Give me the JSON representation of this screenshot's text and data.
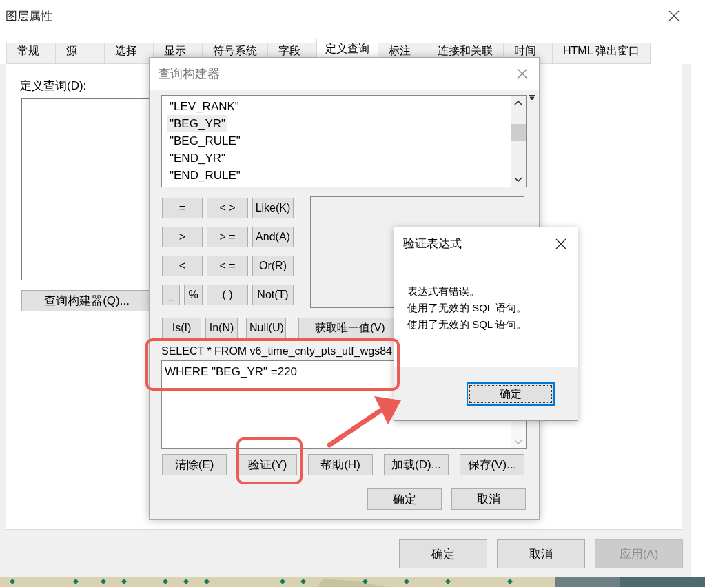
{
  "window": {
    "title": "图层属性"
  },
  "tabs": [
    {
      "label": "常规",
      "selected": false
    },
    {
      "label": "源",
      "selected": false
    },
    {
      "label": "选择",
      "selected": false
    },
    {
      "label": "显示",
      "selected": false
    },
    {
      "label": "符号系统",
      "selected": false
    },
    {
      "label": "字段",
      "selected": false
    },
    {
      "label": "定义查询",
      "selected": true
    },
    {
      "label": "标注",
      "selected": false
    },
    {
      "label": "连接和关联",
      "selected": false
    },
    {
      "label": "时间",
      "selected": false
    },
    {
      "label": "HTML 弹出窗口",
      "selected": false
    }
  ],
  "definition_query": {
    "label": "定义查询(D):",
    "builder_button": "查询构建器(Q)..."
  },
  "buttons": [
    {
      "label": "确定",
      "disabled": false
    },
    {
      "label": "取消",
      "disabled": false
    },
    {
      "label": "应用(A)",
      "disabled": true
    }
  ],
  "query_builder": {
    "title": "查询构建器",
    "fields": [
      {
        "label": "\"LEV_RANK\"",
        "selected": false
      },
      {
        "label": "\"BEG_YR\"",
        "selected": true
      },
      {
        "label": "\"BEG_RULE\"",
        "selected": false
      },
      {
        "label": "\"END_YR\"",
        "selected": false
      },
      {
        "label": "\"END_RULE\"",
        "selected": false
      }
    ],
    "operators": [
      {
        "label": "=",
        "kind": "wide"
      },
      {
        "label": "< >",
        "kind": "wide"
      },
      {
        "label": "Like(K)",
        "kind": "wide"
      },
      {
        "label": ">",
        "kind": "wide"
      },
      {
        "label": "> =",
        "kind": "wide"
      },
      {
        "label": "And(A)",
        "kind": "wide"
      },
      {
        "label": "<",
        "kind": "wide"
      },
      {
        "label": "< =",
        "kind": "wide"
      },
      {
        "label": "Or(R)",
        "kind": "wide"
      },
      {
        "label": "_",
        "kind": "half"
      },
      {
        "label": "%",
        "kind": "half"
      },
      {
        "label": "( )",
        "kind": "wide"
      },
      {
        "label": "Not(T)",
        "kind": "wide"
      }
    ],
    "list_buttons": [
      "Is(I)",
      "In(N)",
      "Null(U)"
    ],
    "unique_values_button": "获取唯一值(V)",
    "select_prefix": "SELECT * FROM v6_time_cnty_pts_utf_wgs84",
    "where_value": "WHERE \"BEG_YR\" =220",
    "action_buttons": [
      "清除(E)",
      "验证(Y)",
      "帮助(H)",
      "加载(D)...",
      "保存(V)..."
    ],
    "dialog_buttons": [
      "确定",
      "取消"
    ]
  },
  "verify_dialog": {
    "title": "验证表达式",
    "messages": [
      "表达式有错误。",
      "使用了无效的 SQL 语句。",
      "使用了无效的 SQL 语句。"
    ],
    "ok_button": {
      "label": "确定",
      "focused": true
    }
  }
}
